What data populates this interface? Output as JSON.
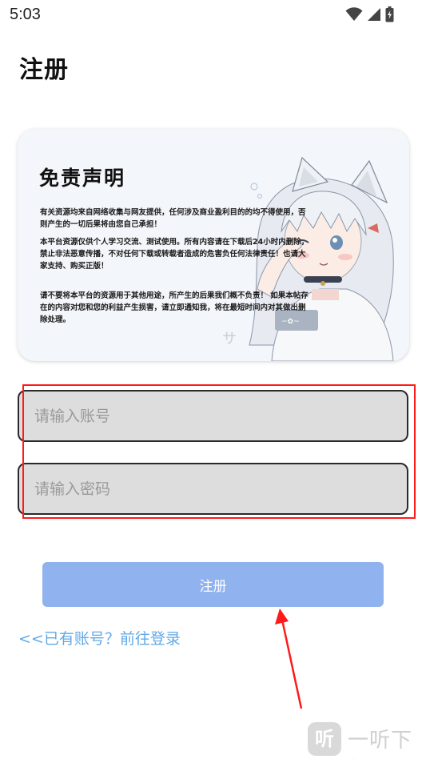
{
  "status_bar": {
    "time": "5:03",
    "icons": [
      "wifi-icon",
      "signal-icon",
      "battery-charging-icon"
    ]
  },
  "page": {
    "title": "注册"
  },
  "banner": {
    "title": "免责声明",
    "paragraph_1": "有关资源均来自网络收集与网友提供，任何涉及商业盈利目的的均不得使用，否则产生的一切后果将由您自己承担！",
    "paragraph_2": "本平台资源仅供个人学习交流、测试使用。所有内容请在下载后24小时内删除，禁止非法恶意传播，不对任何下载或转载者造成的危害负任何法律责任！也请大家支持、购买正版！",
    "paragraph_3": "请不要将本平台的资源用于其他用途，所产生的后果我们概不负责！ 如果本帖存在的内容对您和您的利益产生损害，请立即通知我，将在最短时间内对其做出删除处理。"
  },
  "form": {
    "account_placeholder": "请输入账号",
    "password_placeholder": "请输入密码",
    "account_value": "",
    "password_value": ""
  },
  "actions": {
    "register_label": "注册",
    "login_link_label": "<<已有账号？前往登录"
  },
  "watermark": {
    "logo_char": "听",
    "text": "一听下载"
  },
  "colors": {
    "button": "#90b2ee",
    "link": "#62a9e6",
    "annotation": "#ff1a1a",
    "field_bg": "#dddddd"
  }
}
